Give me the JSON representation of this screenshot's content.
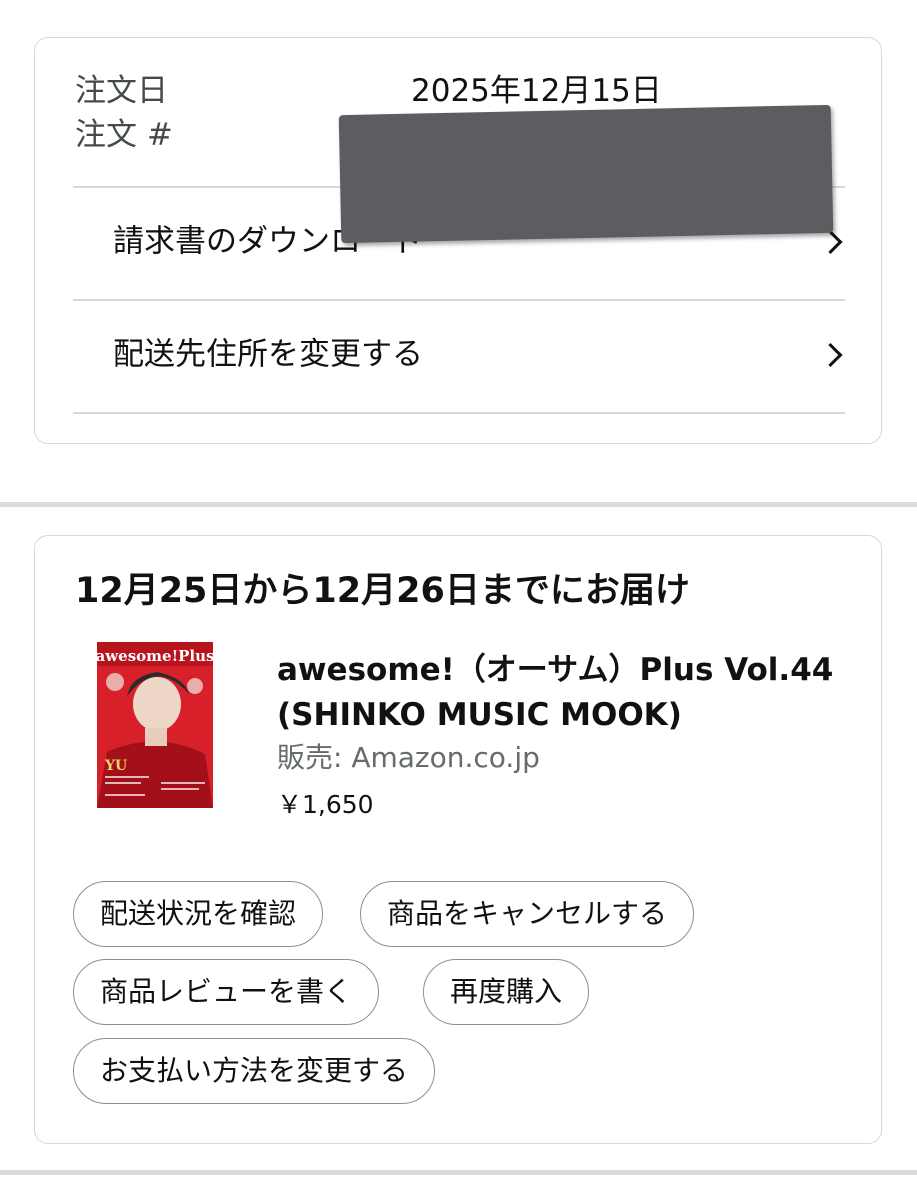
{
  "order": {
    "order_date_label": "注文日",
    "order_date_value": "2025年12月15日",
    "order_number_label": "注文 #",
    "actions": [
      {
        "label": "請求書のダウンロード"
      },
      {
        "label": "配送先住所を変更する"
      }
    ]
  },
  "shipment": {
    "delivery_title": "12月25日から12月26日までにお届け",
    "product": {
      "title": "awesome!（オーサム）Plus Vol.44 (SHINKO MUSIC MOOK)",
      "seller": "販売: Amazon.co.jp",
      "price": "￥1,650",
      "cover_masthead": "awesome!Plus",
      "cover_name": "YU"
    },
    "buttons": [
      {
        "label": "配送状況を確認"
      },
      {
        "label": "商品をキャンセルする"
      },
      {
        "label": "商品レビューを書く"
      },
      {
        "label": "再度購入"
      },
      {
        "label": "お支払い方法を変更する"
      }
    ]
  },
  "icons": {
    "row_chevron": "chevron-right-icon"
  },
  "colors": {
    "card_border": "#d5d9d9",
    "pill_border": "#8d9090",
    "muted_text": "#666b6b",
    "redaction": "#5c5d60",
    "cover_red": "#d8202a"
  }
}
